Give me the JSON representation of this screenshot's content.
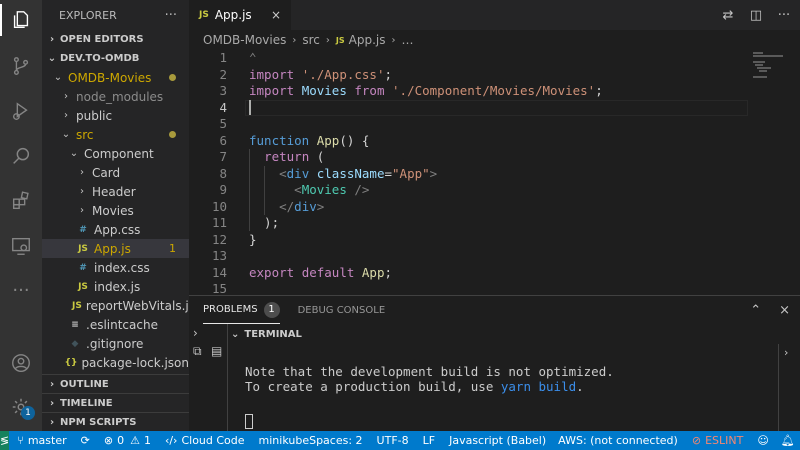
{
  "activity_bar": {
    "icons": [
      "files-icon",
      "source-control-icon",
      "run-debug-icon",
      "search-icon",
      "extensions-icon",
      "remote-explorer-icon",
      "more-icon",
      "account-icon",
      "manage-gear-icon"
    ],
    "manage_badge": "1"
  },
  "sidebar": {
    "title": "EXPLORER",
    "more": "···",
    "open_editors": "OPEN EDITORS",
    "workspace": "DEV.TO-OMDB",
    "tree": [
      {
        "label": "OMDB-Movies",
        "chev": "⌄",
        "indent": 1,
        "icon": "",
        "color": "#cca700",
        "dot": true
      },
      {
        "label": "node_modules",
        "chev": "›",
        "indent": 2,
        "icon": "",
        "color": "#8c8c8c"
      },
      {
        "label": "public",
        "chev": "›",
        "indent": 2,
        "icon": "",
        "color": "#cccccc"
      },
      {
        "label": "src",
        "chev": "⌄",
        "indent": 2,
        "icon": "",
        "color": "#cca700",
        "dot": true
      },
      {
        "label": "Component",
        "chev": "⌄",
        "indent": 3,
        "icon": "",
        "color": "#cccccc"
      },
      {
        "label": "Card",
        "chev": "›",
        "indent": 4,
        "icon": "",
        "color": "#cccccc"
      },
      {
        "label": "Header",
        "chev": "›",
        "indent": 4,
        "icon": "",
        "color": "#cccccc"
      },
      {
        "label": "Movies",
        "chev": "›",
        "indent": 4,
        "icon": "",
        "color": "#cccccc"
      },
      {
        "label": "App.css",
        "chev": "",
        "indent": 3,
        "icon": "#",
        "icon_color": "#519aba",
        "color": "#cccccc"
      },
      {
        "label": "App.js",
        "chev": "",
        "indent": 3,
        "icon": "JS",
        "icon_color": "#cbcb41",
        "color": "#cca700",
        "count": "1",
        "selected": true
      },
      {
        "label": "index.css",
        "chev": "",
        "indent": 3,
        "icon": "#",
        "icon_color": "#519aba",
        "color": "#cccccc"
      },
      {
        "label": "index.js",
        "chev": "",
        "indent": 3,
        "icon": "JS",
        "icon_color": "#cbcb41",
        "color": "#cccccc"
      },
      {
        "label": "reportWebVitals.js",
        "chev": "",
        "indent": 3,
        "icon": "JS",
        "icon_color": "#cbcb41",
        "color": "#cccccc"
      },
      {
        "label": ".eslintcache",
        "chev": "",
        "indent": 2,
        "icon": "≡",
        "icon_color": "#cccccc",
        "color": "#cccccc"
      },
      {
        "label": ".gitignore",
        "chev": "",
        "indent": 2,
        "icon": "◆",
        "icon_color": "#41535b",
        "color": "#cccccc"
      },
      {
        "label": "package-lock.json",
        "chev": "",
        "indent": 2,
        "icon": "{}",
        "icon_color": "#cbcb41",
        "color": "#cccccc"
      }
    ],
    "outline": "OUTLINE",
    "timeline": "TIMELINE",
    "npm_scripts": "NPM SCRIPTS"
  },
  "editor": {
    "tab": {
      "icon": "JS",
      "label": "App.js",
      "close": "×"
    },
    "breadcrumb": [
      "OMDB-Movies",
      "src",
      "App.js",
      "…"
    ],
    "breadcrumb_js": "JS",
    "lines": [
      {
        "n": "1",
        "tokens": [
          [
            "brk",
            "⌃"
          ]
        ]
      },
      {
        "n": "2",
        "tokens": [
          [
            "kw",
            "import"
          ],
          [
            "pun",
            " "
          ],
          [
            "str",
            "'./App.css'"
          ],
          [
            "pun",
            ";"
          ]
        ]
      },
      {
        "n": "3",
        "tokens": [
          [
            "kw",
            "import"
          ],
          [
            "pun",
            " "
          ],
          [
            "id",
            "Movies"
          ],
          [
            "pun",
            " "
          ],
          [
            "kw",
            "from"
          ],
          [
            "pun",
            " "
          ],
          [
            "str",
            "'./Component/Movies/Movies'"
          ],
          [
            "pun",
            ";"
          ]
        ]
      },
      {
        "n": "4",
        "tokens": [],
        "current": true
      },
      {
        "n": "5",
        "tokens": []
      },
      {
        "n": "6",
        "tokens": [
          [
            "tag",
            "function"
          ],
          [
            "pun",
            " "
          ],
          [
            "fn",
            "App"
          ],
          [
            "pun",
            "() {"
          ]
        ]
      },
      {
        "n": "7",
        "tokens": [
          [
            "pun",
            "  "
          ],
          [
            "kw",
            "return"
          ],
          [
            "pun",
            " ("
          ]
        ]
      },
      {
        "n": "8",
        "tokens": [
          [
            "pun",
            "    "
          ],
          [
            "brk",
            "<"
          ],
          [
            "tag",
            "div"
          ],
          [
            "pun",
            " "
          ],
          [
            "id",
            "className"
          ],
          [
            "pun",
            "="
          ],
          [
            "str",
            "\"App\""
          ],
          [
            "brk",
            ">"
          ]
        ]
      },
      {
        "n": "9",
        "tokens": [
          [
            "pun",
            "      "
          ],
          [
            "brk",
            "<"
          ],
          [
            "comp",
            "Movies"
          ],
          [
            "pun",
            " "
          ],
          [
            "brk",
            "/>"
          ]
        ]
      },
      {
        "n": "10",
        "tokens": [
          [
            "pun",
            "    "
          ],
          [
            "brk",
            "</"
          ],
          [
            "tag",
            "div"
          ],
          [
            "brk",
            ">"
          ]
        ]
      },
      {
        "n": "11",
        "tokens": [
          [
            "pun",
            "  );"
          ]
        ]
      },
      {
        "n": "12",
        "tokens": [
          [
            "pun",
            "}"
          ]
        ]
      },
      {
        "n": "13",
        "tokens": []
      },
      {
        "n": "14",
        "tokens": [
          [
            "kw",
            "export"
          ],
          [
            "pun",
            " "
          ],
          [
            "kw",
            "default"
          ],
          [
            "pun",
            " "
          ],
          [
            "fn",
            "App"
          ],
          [
            "pun",
            ";"
          ]
        ]
      },
      {
        "n": "15",
        "tokens": []
      }
    ]
  },
  "panel": {
    "tabs": [
      {
        "label": "PROBLEMS",
        "badge": "1",
        "active": true
      },
      {
        "label": "DEBUG CONSOLE",
        "badge": "",
        "active": false
      }
    ],
    "terminal_title": "TERMINAL",
    "terminal_line1": "Note that the development build is not optimized.",
    "terminal_line2_pre": "To create a production build, use ",
    "terminal_line2_hl": "yarn build",
    "terminal_line2_post": "."
  },
  "status_bar": {
    "remote_icon": "≶",
    "branch": "master",
    "sync_icon": "⟳",
    "errors": "0",
    "warnings": "1",
    "cloud_code": "Cloud Code",
    "minikube": "minikube",
    "spaces": "Spaces: 2",
    "encoding": "UTF-8",
    "eol": "LF",
    "language": "Javascript (Babel)",
    "aws": "AWS: (not connected)",
    "eslint": "ESLINT",
    "eslint_color": "#f48771"
  },
  "colors": {
    "accent": "#007acc",
    "remote": "#16825d",
    "modified": "#cca700"
  }
}
